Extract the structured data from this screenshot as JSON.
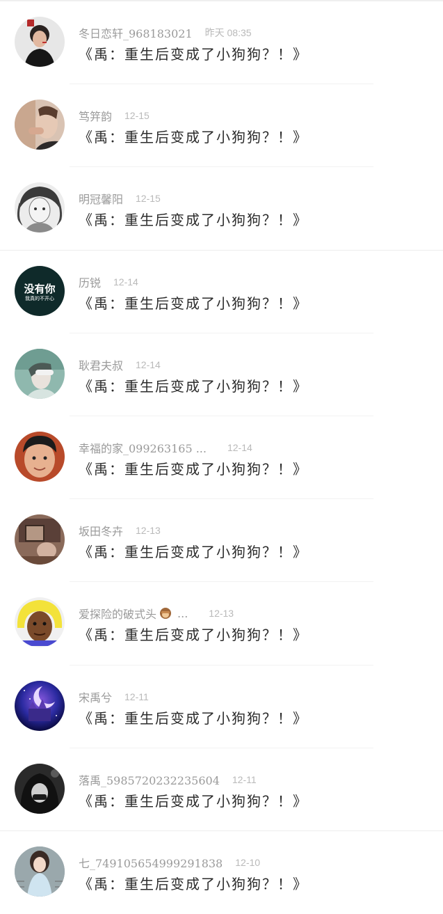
{
  "message_text": "《禹：重生后变成了小狗狗？！》",
  "conversations": [
    {
      "name": "冬日恋轩_968183021",
      "time": "昨天 08:35",
      "avatar": "avatar-man-microphone-icon"
    },
    {
      "name": "笃笄韵",
      "time": "12-15",
      "avatar": "avatar-hand-face-photo-icon"
    },
    {
      "name": "明冠馨阳",
      "time": "12-15",
      "avatar": "avatar-anime-sketch-icon"
    },
    {
      "name": "历锐",
      "time": "12-14",
      "avatar": "avatar-text-badge-icon",
      "avatar_text": "没有你",
      "avatar_subtext": "我真的不开心"
    },
    {
      "name": "耿君夫叔",
      "time": "12-14",
      "avatar": "avatar-teal-portrait-icon"
    },
    {
      "name": "幸福的家_099263165 ...",
      "time": "12-14",
      "avatar": "avatar-child-photo-icon"
    },
    {
      "name": "坂田冬卉",
      "time": "12-13",
      "avatar": "avatar-sepia-photo-icon"
    },
    {
      "name": "爱探险的破式头",
      "name_suffix": "...",
      "time": "12-13",
      "avatar": "avatar-yellow-wig-icon"
    },
    {
      "name": "宋禹兮",
      "time": "12-11",
      "avatar": "avatar-galaxy-castle-icon"
    },
    {
      "name": "落禹_5985720232235604",
      "time": "12-11",
      "avatar": "avatar-dark-hoodie-icon"
    },
    {
      "name": "七_7491056549992918​38",
      "time": "12-10",
      "avatar": "avatar-girl-illustration-icon"
    }
  ],
  "colors": {
    "name": "#9a9a9a",
    "time": "#b9b9b9",
    "message": "#2b2b2b",
    "divider": "#f2f2f2"
  }
}
